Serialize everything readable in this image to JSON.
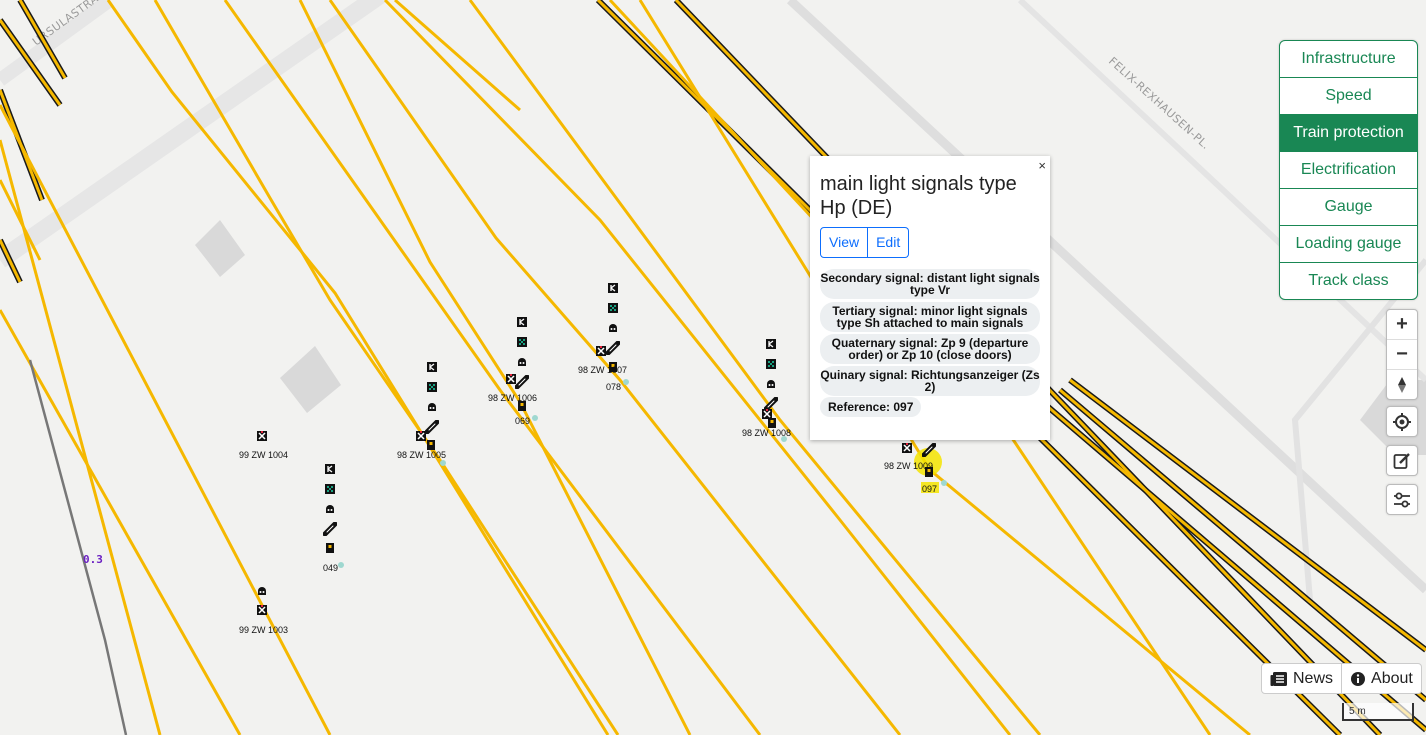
{
  "map": {
    "street_labels": {
      "top_left": "URSULASTRASSE",
      "top_right": "FELIX-REXHAUSEN-PL."
    },
    "km_marker": "0.3",
    "signals": [
      {
        "name": "99 ZW 1004"
      },
      {
        "name": "99 ZW 1003"
      },
      {
        "name": "98 ZW 1005"
      },
      {
        "name": "98 ZW 1006"
      },
      {
        "name": "98 ZW 1007"
      },
      {
        "name": "98 ZW 1008"
      },
      {
        "name": "98 ZW 1009"
      }
    ],
    "refs": [
      "049",
      "069",
      "078",
      "097"
    ],
    "colors": {
      "track": "#f5b800",
      "track_casing": "#1a1a1a",
      "aspect_green": "#1dd3a7",
      "stop_red": "#e5223b"
    }
  },
  "layers": {
    "items": [
      "Infrastructure",
      "Speed",
      "Train protection",
      "Electrification",
      "Gauge",
      "Loading gauge",
      "Track class"
    ],
    "active": "Train protection",
    "accent": "#198754"
  },
  "controls": {
    "zoom_in": "+",
    "zoom_out": "−"
  },
  "popup": {
    "close": "×",
    "title": "main light signals type Hp (DE)",
    "view_label": "View",
    "edit_label": "Edit",
    "details": [
      "Secondary signal: distant light signals type Vr",
      "Tertiary signal: minor light signals type Sh attached to main signals",
      "Quaternary signal: Zp 9 (departure order) or Zp 10 (close doors)",
      "Quinary signal: Richtungsanzeiger (Zs 2)"
    ],
    "reference": "Reference: 097"
  },
  "footer": {
    "news_label": "News",
    "about_label": "About",
    "scale_label": "5 m"
  }
}
